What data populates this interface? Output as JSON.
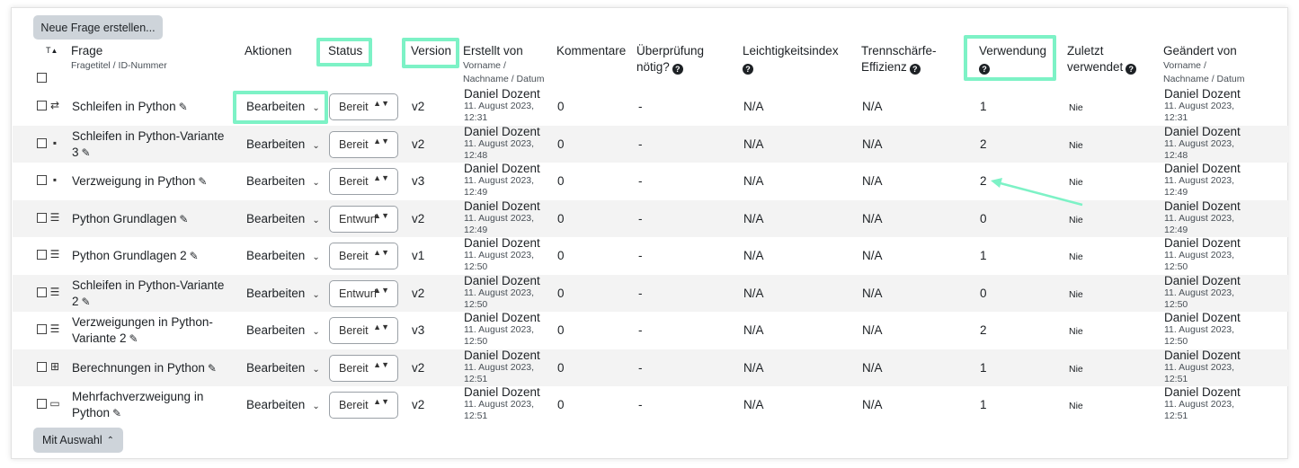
{
  "toolbar": {
    "new_question": "Neue Frage erstellen...",
    "with_selection": "Mit Auswahl",
    "with_selection_caret": "⌃"
  },
  "headers": {
    "sort_type": "T",
    "frage": "Frage",
    "frage_sub": "Fragetitel / ID-Nummer",
    "aktionen": "Aktionen",
    "status": "Status",
    "version": "Version",
    "erstellt": "Erstellt von",
    "erstellt_sub1": "Vorname /",
    "erstellt_sub2": "Nachname / Datum",
    "kommentare": "Kommentare",
    "ueberpruefung1": "Überprüfung",
    "ueberpruefung2": "nötig?",
    "leicht": "Leichtigkeitsindex",
    "trenn1": "Trennschärfe-",
    "trenn2": "Effizienz",
    "verwendung": "Verwendung",
    "zuletzt1": "Zuletzt",
    "zuletzt2": "verwendet",
    "geaendert": "Geändert von",
    "geaendert_sub1": "Vorname /",
    "geaendert_sub2": "Nachname / Datum",
    "help_glyph": "?"
  },
  "icons": {
    "pencil": "✎",
    "chevron": "⌄",
    "updown": "▲▼"
  },
  "rows": [
    {
      "icon": "⇄",
      "icon_name": "drag-drop-icon",
      "title_l1": "Schleifen in Python",
      "title_l2": "",
      "action": "Bearbeiten",
      "status": "Bereit",
      "version": "v2",
      "creator": "Daniel Dozent",
      "c_date1": "11. August 2023,",
      "c_date2": "12:31",
      "comments": "0",
      "review": "-",
      "ease": "N/A",
      "disc": "N/A",
      "usage": "1",
      "last_used": "Nie",
      "modifier": "Daniel Dozent",
      "m_date1": "11. August 2023,",
      "m_date2": "12:31"
    },
    {
      "icon": "▪",
      "icon_name": "gapselect-icon",
      "title_l1": "Schleifen in Python-Variante",
      "title_l2": "3",
      "action": "Bearbeiten",
      "status": "Bereit",
      "version": "v2",
      "creator": "Daniel Dozent",
      "c_date1": "11. August 2023,",
      "c_date2": "12:48",
      "comments": "0",
      "review": "-",
      "ease": "N/A",
      "disc": "N/A",
      "usage": "2",
      "last_used": "Nie",
      "modifier": "Daniel Dozent",
      "m_date1": "11. August 2023,",
      "m_date2": "12:48"
    },
    {
      "icon": "▪",
      "icon_name": "gapselect-icon",
      "title_l1": "Verzweigung in Python",
      "title_l2": "",
      "action": "Bearbeiten",
      "status": "Bereit",
      "version": "v3",
      "creator": "Daniel Dozent",
      "c_date1": "11. August 2023,",
      "c_date2": "12:49",
      "comments": "0",
      "review": "-",
      "ease": "N/A",
      "disc": "N/A",
      "usage": "2",
      "last_used": "Nie",
      "modifier": "Daniel Dozent",
      "m_date1": "11. August 2023,",
      "m_date2": "12:49"
    },
    {
      "icon": "☰",
      "icon_name": "multichoice-icon",
      "title_l1": "Python Grundlagen",
      "title_l2": "",
      "action": "Bearbeiten",
      "status": "Entwurf",
      "version": "v2",
      "creator": "Daniel Dozent",
      "c_date1": "11. August 2023,",
      "c_date2": "12:49",
      "comments": "0",
      "review": "-",
      "ease": "N/A",
      "disc": "N/A",
      "usage": "0",
      "last_used": "Nie",
      "modifier": "Daniel Dozent",
      "m_date1": "11. August 2023,",
      "m_date2": "12:49"
    },
    {
      "icon": "☰",
      "icon_name": "multichoice-icon",
      "title_l1": "Python Grundlagen 2",
      "title_l2": "",
      "action": "Bearbeiten",
      "status": "Bereit",
      "version": "v1",
      "creator": "Daniel Dozent",
      "c_date1": "11. August 2023,",
      "c_date2": "12:50",
      "comments": "0",
      "review": "-",
      "ease": "N/A",
      "disc": "N/A",
      "usage": "1",
      "last_used": "Nie",
      "modifier": "Daniel Dozent",
      "m_date1": "11. August 2023,",
      "m_date2": "12:50"
    },
    {
      "icon": "☰",
      "icon_name": "multichoice-icon",
      "title_l1": "Schleifen in Python-Variante",
      "title_l2": "2",
      "action": "Bearbeiten",
      "status": "Entwurf",
      "version": "v2",
      "creator": "Daniel Dozent",
      "c_date1": "11. August 2023,",
      "c_date2": "12:50",
      "comments": "0",
      "review": "-",
      "ease": "N/A",
      "disc": "N/A",
      "usage": "0",
      "last_used": "Nie",
      "modifier": "Daniel Dozent",
      "m_date1": "11. August 2023,",
      "m_date2": "12:50"
    },
    {
      "icon": "☰",
      "icon_name": "multichoice-icon",
      "title_l1": "Verzweigungen in Python-",
      "title_l2": "Variante 2",
      "action": "Bearbeiten",
      "status": "Bereit",
      "version": "v3",
      "creator": "Daniel Dozent",
      "c_date1": "11. August 2023,",
      "c_date2": "12:50",
      "comments": "0",
      "review": "-",
      "ease": "N/A",
      "disc": "N/A",
      "usage": "2",
      "last_used": "Nie",
      "modifier": "Daniel Dozent",
      "m_date1": "11. August 2023,",
      "m_date2": "12:50"
    },
    {
      "icon": "⊞",
      "icon_name": "calculated-icon",
      "title_l1": "Berechnungen in Python",
      "title_l2": "",
      "action": "Bearbeiten",
      "status": "Bereit",
      "version": "v2",
      "creator": "Daniel Dozent",
      "c_date1": "11. August 2023,",
      "c_date2": "12:51",
      "comments": "0",
      "review": "-",
      "ease": "N/A",
      "disc": "N/A",
      "usage": "1",
      "last_used": "Nie",
      "modifier": "Daniel Dozent",
      "m_date1": "11. August 2023,",
      "m_date2": "12:51"
    },
    {
      "icon": "▭",
      "icon_name": "shortanswer-icon",
      "title_l1": "Mehrfachverzweigung in",
      "title_l2": "Python",
      "action": "Bearbeiten",
      "status": "Bereit",
      "version": "v2",
      "creator": "Daniel Dozent",
      "c_date1": "11. August 2023,",
      "c_date2": "12:51",
      "comments": "0",
      "review": "-",
      "ease": "N/A",
      "disc": "N/A",
      "usage": "1",
      "last_used": "Nie",
      "modifier": "Daniel Dozent",
      "m_date1": "11. August 2023,",
      "m_date2": "12:51"
    }
  ],
  "colors": {
    "highlight": "#7df2c6",
    "row_alt": "#f3f3f3",
    "button_gray": "#ced4da"
  }
}
